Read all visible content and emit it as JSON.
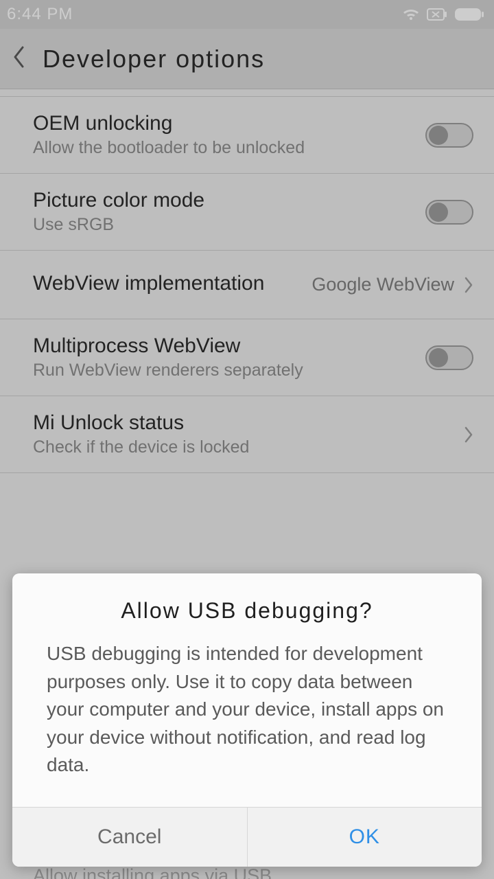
{
  "status": {
    "time": "6:44 PM"
  },
  "header": {
    "title": "Developer  options"
  },
  "rows": {
    "oem": {
      "title": "OEM unlocking",
      "sub": "Allow the bootloader to be unlocked"
    },
    "pcm": {
      "title": "Picture color mode",
      "sub": "Use sRGB"
    },
    "webview": {
      "title": "WebView implementation",
      "value": "Google WebView"
    },
    "mpw": {
      "title": "Multiprocess WebView",
      "sub": "Run WebView renderers separately"
    },
    "miu": {
      "title": "Mi Unlock status",
      "sub": "Check if the device is locked"
    }
  },
  "peek": "Allow installing apps via USB",
  "dialog": {
    "title": "Allow  USB  debugging?",
    "body": "USB debugging is intended for development purposes only. Use it to copy data between your computer and your device, install apps on your device without notification, and read log data.",
    "cancel": "Cancel",
    "ok": "OK"
  }
}
